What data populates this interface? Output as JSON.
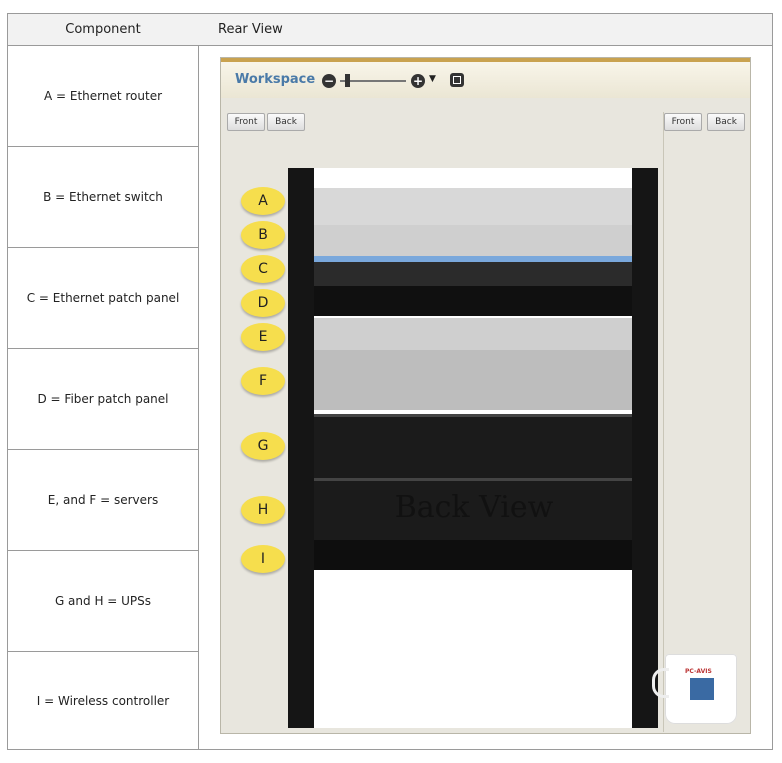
{
  "table": {
    "col_component": "Component",
    "col_view": "Rear View",
    "rows": [
      {
        "label": "A = Ethernet router"
      },
      {
        "label": "B = Ethernet switch"
      },
      {
        "label": "C = Ethernet patch panel"
      },
      {
        "label": "D = Fiber patch panel"
      },
      {
        "label": "E, and F = servers"
      },
      {
        "label": "G and H = UPSs"
      },
      {
        "label": "I = Wireless controller"
      }
    ]
  },
  "workspace": {
    "title": "Workspace",
    "buttons": {
      "front": "Front",
      "back": "Back"
    },
    "callouts": [
      "A",
      "B",
      "C",
      "D",
      "E",
      "F",
      "G",
      "H",
      "I"
    ],
    "back_label": "Back View"
  },
  "mug": {
    "text": "PC-AVIS"
  }
}
